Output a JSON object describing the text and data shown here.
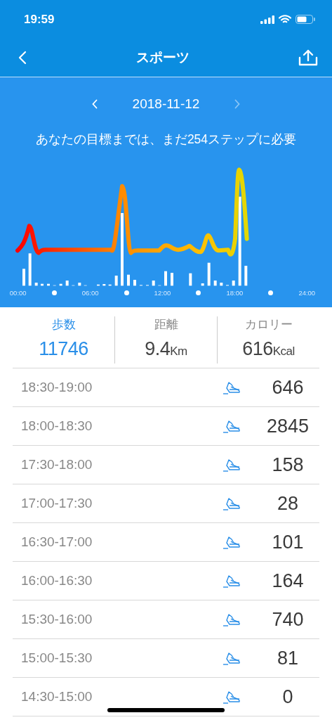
{
  "status_bar": {
    "time": "19:59"
  },
  "nav_bar": {
    "title": "スポーツ"
  },
  "date_nav": {
    "date": "2018-11-12",
    "next_disabled": true
  },
  "goal_message": "あなたの目標までは、まだ254ステップに必要",
  "chart": {
    "axis_labels": [
      "00:00",
      "06:00",
      "12:00",
      "18:00",
      "24:00"
    ]
  },
  "stats": [
    {
      "label": "歩数",
      "value": "11746",
      "selected": true
    },
    {
      "label": "距離",
      "value": "9.4",
      "unit": "Km",
      "selected": false
    },
    {
      "label": "カロリー",
      "value": "616",
      "unit": "Kcal",
      "selected": false
    }
  ],
  "rows": [
    {
      "time": "18:30-19:00",
      "steps": "646"
    },
    {
      "time": "18:00-18:30",
      "steps": "2845"
    },
    {
      "time": "17:30-18:00",
      "steps": "158"
    },
    {
      "time": "17:00-17:30",
      "steps": "28"
    },
    {
      "time": "16:30-17:00",
      "steps": "101"
    },
    {
      "time": "16:00-16:30",
      "steps": "164"
    },
    {
      "time": "15:30-16:00",
      "steps": "740"
    },
    {
      "time": "15:00-15:30",
      "steps": "81"
    },
    {
      "time": "14:30-15:00",
      "steps": "0"
    }
  ]
}
